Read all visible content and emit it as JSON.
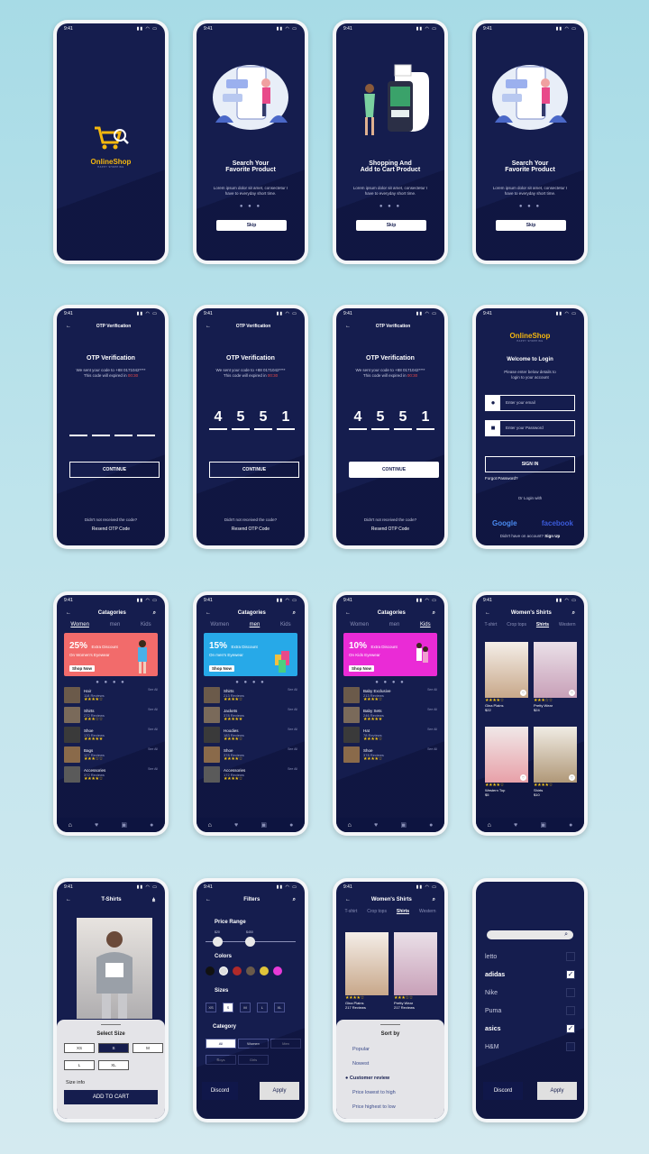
{
  "status_time": "9:41",
  "status_icons": "▮▮ ◠ ▭",
  "splash": {
    "brand": "OnlineShop",
    "tagline": "HAPPY SHOPPING"
  },
  "onboarding": [
    {
      "title_line1": "Search Your",
      "title_line2": "Favorite Product",
      "body": "Lorem ipsum dolor sit amet, consectetur I have to everyday short time.",
      "dots": "● ● ●",
      "skip": "Skip"
    },
    {
      "title_line1": "Shopping And",
      "title_line2": "Add to Cart Product",
      "body": "Lorem ipsum dolor sit amet, consectetur I have to everyday short time.",
      "dots": "● ● ●",
      "skip": "Skip"
    },
    {
      "title_line1": "Search Your",
      "title_line2": "Favorite Product",
      "body": "Lorem ipsum dolor sit amet, consectetur I have to everyday short time.",
      "dots": "● ● ●",
      "skip": "Skip"
    }
  ],
  "otp": {
    "header": "OTP Verification",
    "title": "OTP Verification",
    "line1": "We sent your code to +88 0171042****",
    "line2": "This code will expired in",
    "timer": "00:30",
    "digits": [
      "4",
      "5",
      "5",
      "1"
    ],
    "continue": "CONTINUE",
    "not_received": "Didn't not received the code?",
    "resend": "Resend OTP Code"
  },
  "login": {
    "brand": "OnlineShop",
    "tagline": "HAPPY SHOPPING",
    "title": "Welcome to Login",
    "subtitle1": "Please enter below details to",
    "subtitle2": "login to your account",
    "email_placeholder": "Enter your email",
    "password_placeholder": "Enter your Password",
    "sign_in": "SIGN IN",
    "forgot": "Forgot Password?",
    "or_login": "Or Login with",
    "google": "Google",
    "facebook": "facebook",
    "no_account": "Didn't have on account?",
    "sign_up": "Sign Up"
  },
  "categories": {
    "title": "Catagories",
    "tabs": [
      "Women",
      "men",
      "Kids"
    ],
    "see_all": "See All",
    "nav_icons": [
      "⌂",
      "♥",
      "🛒",
      "●"
    ],
    "screens": [
      {
        "active": 0,
        "pct": "25%",
        "extra": "Extra Discount",
        "on": "On Women's Eyewear",
        "shop": "Shop Now",
        "color": "#f26b6b",
        "rows": [
          {
            "name": "Hair",
            "reviews": "118 Reviews",
            "stars": "★★★★☆"
          },
          {
            "name": "Shirts",
            "reviews": "272 Reviews",
            "stars": "★★★☆☆"
          },
          {
            "name": "Shoe",
            "reviews": "170 Reviews",
            "stars": "★★★★★"
          },
          {
            "name": "Bags",
            "reviews": "127 Reviews",
            "stars": "★★★☆☆"
          },
          {
            "name": "Accessories",
            "reviews": "372 Reviews",
            "stars": "★★★★☆"
          }
        ]
      },
      {
        "active": 1,
        "pct": "15%",
        "extra": "Extra Discount",
        "on": "On men's Eyewear",
        "shop": "Shop Now",
        "color": "#27a9e8",
        "rows": [
          {
            "name": "Shirts",
            "reviews": "213 Reviews",
            "stars": "★★★★☆"
          },
          {
            "name": "Jackets",
            "reviews": "378 Reviews",
            "stars": "★★★★★"
          },
          {
            "name": "Hoodies",
            "reviews": "183 Reviews",
            "stars": "★★★★☆"
          },
          {
            "name": "Shoe",
            "reviews": "378 Reviews",
            "stars": "★★★★☆"
          },
          {
            "name": "Accessories",
            "reviews": "172 Reviews",
            "stars": "★★★★☆"
          }
        ]
      },
      {
        "active": 2,
        "pct": "10%",
        "extra": "Extra Discount",
        "on": "On Kids Eyewear",
        "shop": "Shop Now",
        "color": "#ea2bd6",
        "rows": [
          {
            "name": "Baby Exclusive",
            "reviews": "213 Reviews",
            "stars": "★★★★☆"
          },
          {
            "name": "Baby Sets",
            "reviews": "246 Reviews",
            "stars": "★★★★★"
          },
          {
            "name": "Hat",
            "reviews": "78 Reviews",
            "stars": "★★★★☆"
          },
          {
            "name": "Shoe",
            "reviews": "378 Reviews",
            "stars": "★★★★☆"
          }
        ]
      }
    ]
  },
  "womens_shirts": {
    "title": "Women's Shirts",
    "tabs": [
      "T-shirt",
      "Crop tops",
      "Shirts",
      "Western"
    ],
    "products": [
      {
        "name": "Gina Plains",
        "price": "$22",
        "stars": "★★★★☆"
      },
      {
        "name": "Pretty Wear",
        "price": "$24",
        "stars": "★★★☆☆"
      },
      {
        "name": "Western Top",
        "price": "$5",
        "stars": "★★★★☆"
      },
      {
        "name": "Shirts",
        "price": "$10",
        "stars": "★★★★☆"
      }
    ]
  },
  "tshirt": {
    "title": "T-Shirts",
    "select_size": "Select Size",
    "sizes": [
      "XS",
      "S",
      "M",
      "L",
      "XL"
    ],
    "size_info": "Size info",
    "add_to_cart": "ADD TO CART"
  },
  "filters": {
    "title": "Filters",
    "price_range": "Price Range",
    "min": "$20",
    "max": "$450",
    "colors_label": "Colors",
    "colors": [
      "#111111",
      "#dddddd",
      "#b02a2a",
      "#6a5a4a",
      "#e0c43a",
      "#e83ad8"
    ],
    "sizes_label": "Sizes",
    "sizes": [
      "XS",
      "S",
      "M",
      "L",
      "XL"
    ],
    "category_label": "Category",
    "categories": [
      "All",
      "Women",
      "Men",
      "Boys",
      "Girls"
    ],
    "discard": "Discord",
    "apply": "Apply"
  },
  "sort": {
    "title": "Women's Shirts",
    "tabs": [
      "T-shirt",
      "Crop tops",
      "Shirts",
      "Western"
    ],
    "products": [
      {
        "name": "Gina Plains",
        "reviews": "217 Reviews",
        "stars": "★★★★☆"
      },
      {
        "name": "Pretty Wear",
        "reviews": "217 Reviews",
        "stars": "★★★☆☆"
      }
    ],
    "sheet_title": "Sort by",
    "options": [
      "Popular",
      "Nowest",
      "Customer review",
      "Price lowest to high",
      "Price highest to low"
    ]
  },
  "brands": {
    "items": [
      {
        "name": "letto",
        "checked": false
      },
      {
        "name": "adidas",
        "checked": true
      },
      {
        "name": "Nike",
        "checked": false
      },
      {
        "name": "Puma",
        "checked": false
      },
      {
        "name": "asics",
        "checked": true
      },
      {
        "name": "H&M",
        "checked": false
      }
    ],
    "discard": "Discord",
    "apply": "Apply"
  }
}
